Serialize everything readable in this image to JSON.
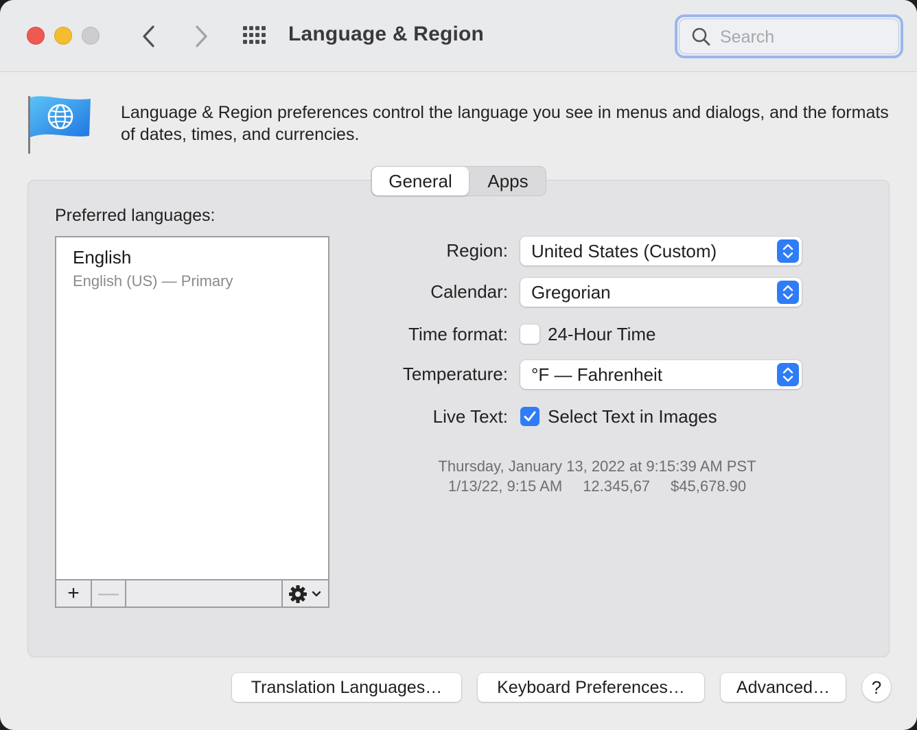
{
  "window": {
    "title": "Language & Region",
    "search_placeholder": "Search"
  },
  "header": {
    "description": "Language & Region preferences control the language you see in menus and dialogs, and the formats of dates, times, and currencies.",
    "icon": "globe-flag-icon"
  },
  "tabs": [
    {
      "label": "General",
      "selected": true
    },
    {
      "label": "Apps",
      "selected": false
    }
  ],
  "languages": {
    "heading": "Preferred languages:",
    "items": [
      {
        "name": "English",
        "detail": "English (US) — Primary"
      }
    ],
    "add_label": "+",
    "remove_label": "—"
  },
  "settings": {
    "region": {
      "label": "Region:",
      "value": "United States (Custom)"
    },
    "calendar": {
      "label": "Calendar:",
      "value": "Gregorian"
    },
    "time_format": {
      "label": "Time format:",
      "option": "24-Hour Time",
      "checked": false
    },
    "temperature": {
      "label": "Temperature:",
      "value": "°F — Fahrenheit"
    },
    "live_text": {
      "label": "Live Text:",
      "option": "Select Text in Images",
      "checked": true
    }
  },
  "sample": {
    "full_date": "Thursday, January 13, 2022 at 9:15:39 AM PST",
    "short_date": "1/13/22, 9:15 AM",
    "number": "12.345,67",
    "currency": "$45,678.90"
  },
  "buttons": {
    "translation": "Translation Languages…",
    "keyboard": "Keyboard Preferences…",
    "advanced": "Advanced…",
    "help": "?"
  },
  "colors": {
    "accent": "#2f7cf6",
    "close": "#ee5a52",
    "minimize": "#f4bd2f",
    "zoom_disabled": "#cdcdcf"
  }
}
